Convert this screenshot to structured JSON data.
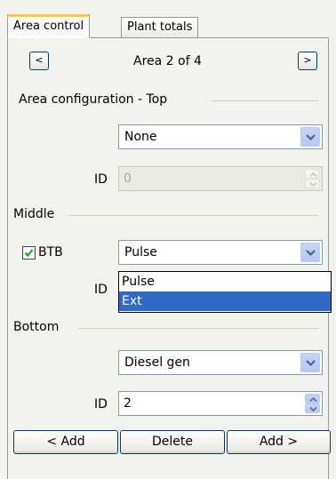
{
  "tabs": [
    {
      "label": "Area control",
      "active": true
    },
    {
      "label": "Plant totals",
      "active": false
    }
  ],
  "nav": {
    "prev_label": "<",
    "next_label": ">",
    "area_label": "Area 2 of 4"
  },
  "top": {
    "heading": "Area configuration - Top",
    "type_value": "None",
    "id_label": "ID",
    "id_value": "0",
    "id_enabled": false
  },
  "middle": {
    "heading": "Middle",
    "checkbox_label": "BTB",
    "checkbox_checked": true,
    "type_value": "Pulse",
    "id_label": "ID",
    "dropdown_open": true,
    "dropdown_options": [
      "Pulse",
      "Ext"
    ],
    "dropdown_selected": "Ext"
  },
  "bottom": {
    "heading": "Bottom",
    "type_value": "Diesel gen",
    "id_label": "ID",
    "id_value": "2"
  },
  "buttons": {
    "add_before": "< Add",
    "delete": "Delete",
    "add_after": "Add >"
  },
  "colors": {
    "selection": "#316ac5",
    "active_tab_accent": "#ffc83c",
    "check_mark": "#21a121"
  }
}
